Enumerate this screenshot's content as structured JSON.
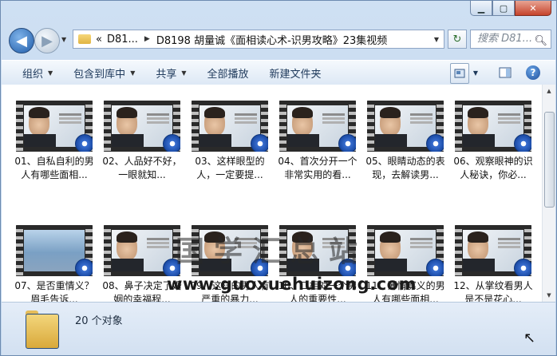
{
  "window": {
    "controls": {
      "minimize": "▁",
      "maximize": "▢",
      "close": "✕"
    }
  },
  "nav": {
    "back_icon": "◀",
    "forward_icon": "▶",
    "address": {
      "chevron": "«",
      "segment1": "D81...",
      "segment2": "D8198 胡量诚《面相读心术-识男攻略》23集视频"
    },
    "search_placeholder": "搜索 D81...",
    "refresh_icon": "↻"
  },
  "toolbar": {
    "organize": "组织",
    "include_library": "包含到库中",
    "share": "共享",
    "play_all": "全部播放",
    "new_folder": "新建文件夹",
    "help": "?"
  },
  "files": [
    {
      "name": "01、自私自利的男人有哪些面相...",
      "thumb": "portrait"
    },
    {
      "name": "02、人品好不好，一眼就知...",
      "thumb": "portrait"
    },
    {
      "name": "03、这样眼型的人，一定要提...",
      "thumb": "portrait"
    },
    {
      "name": "04、首次分开一个非常实用的看...",
      "thumb": "portrait"
    },
    {
      "name": "05、眼睛动态的表现，去解读男...",
      "thumb": "portrait"
    },
    {
      "name": "06、观察眼神的识人秘诀，你必...",
      "thumb": "portrait"
    },
    {
      "name": "07、是否重情义？眉毛告诉...",
      "thumb": "landscape"
    },
    {
      "name": "08、鼻子决定了婚姻的幸福程...",
      "thumb": "portrait"
    },
    {
      "name": "09、这样的男人有严重的暴力...",
      "thumb": "portrait"
    },
    {
      "name": "10、口相对一个男人的重要性...",
      "thumb": "portrait"
    },
    {
      "name": "11、薄情寡义的男人有哪些面相...",
      "thumb": "portrait"
    },
    {
      "name": "12、从掌纹看男人是不是花心...",
      "thumb": "portrait"
    }
  ],
  "watermark": {
    "cn": "国学汇总站",
    "url": "www.guoxuehuizong.com"
  },
  "status": {
    "count": "20 个对象"
  }
}
